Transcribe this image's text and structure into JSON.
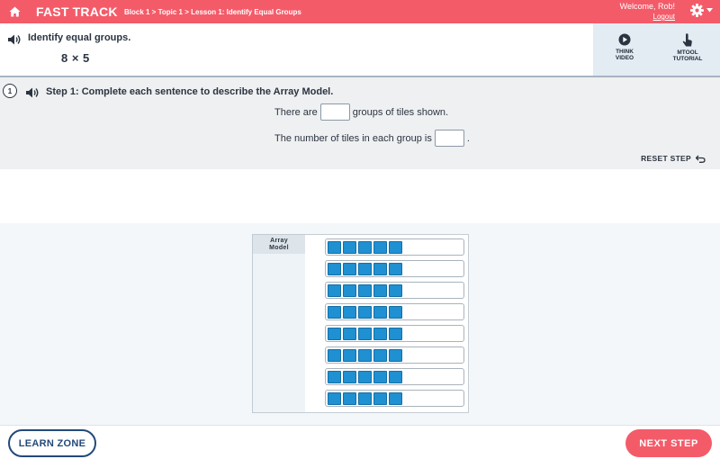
{
  "header": {
    "brand": "FAST TRACK",
    "breadcrumb": "Block 1 > Topic 1 > Lesson 1: Identify Equal Groups",
    "welcome": "Welcome, Rob!",
    "logout": "Logout",
    "home_icon": "home-icon",
    "settings_icon": "gear-icon"
  },
  "question": {
    "prompt": "Identify equal groups.",
    "expression": "8 × 5"
  },
  "tools": [
    {
      "label_line1": "THINK",
      "label_line2": "VIDEO",
      "icon": "play-icon"
    },
    {
      "label_line1": "MTOOL",
      "label_line2": "TUTORIAL",
      "icon": "tap-hand-icon"
    }
  ],
  "step": {
    "number": "1",
    "title": "Step 1: Complete each sentence to describe the Array Model.",
    "sentence1_before": "There are",
    "sentence1_after": "groups of tiles shown.",
    "sentence2_before": "The number of tiles in each group is",
    "sentence2_after": ".",
    "reset_label": "RESET STEP"
  },
  "array_model": {
    "label_line1": "Array",
    "label_line2": "Model",
    "rows": [
      5,
      5,
      5,
      5,
      5,
      5,
      5,
      5
    ]
  },
  "footer": {
    "learn_zone": "LEARN ZONE",
    "next_step": "NEXT STEP"
  },
  "colors": {
    "accent": "#f45b69",
    "tile": "#1f90d1",
    "navy": "#24497a"
  }
}
